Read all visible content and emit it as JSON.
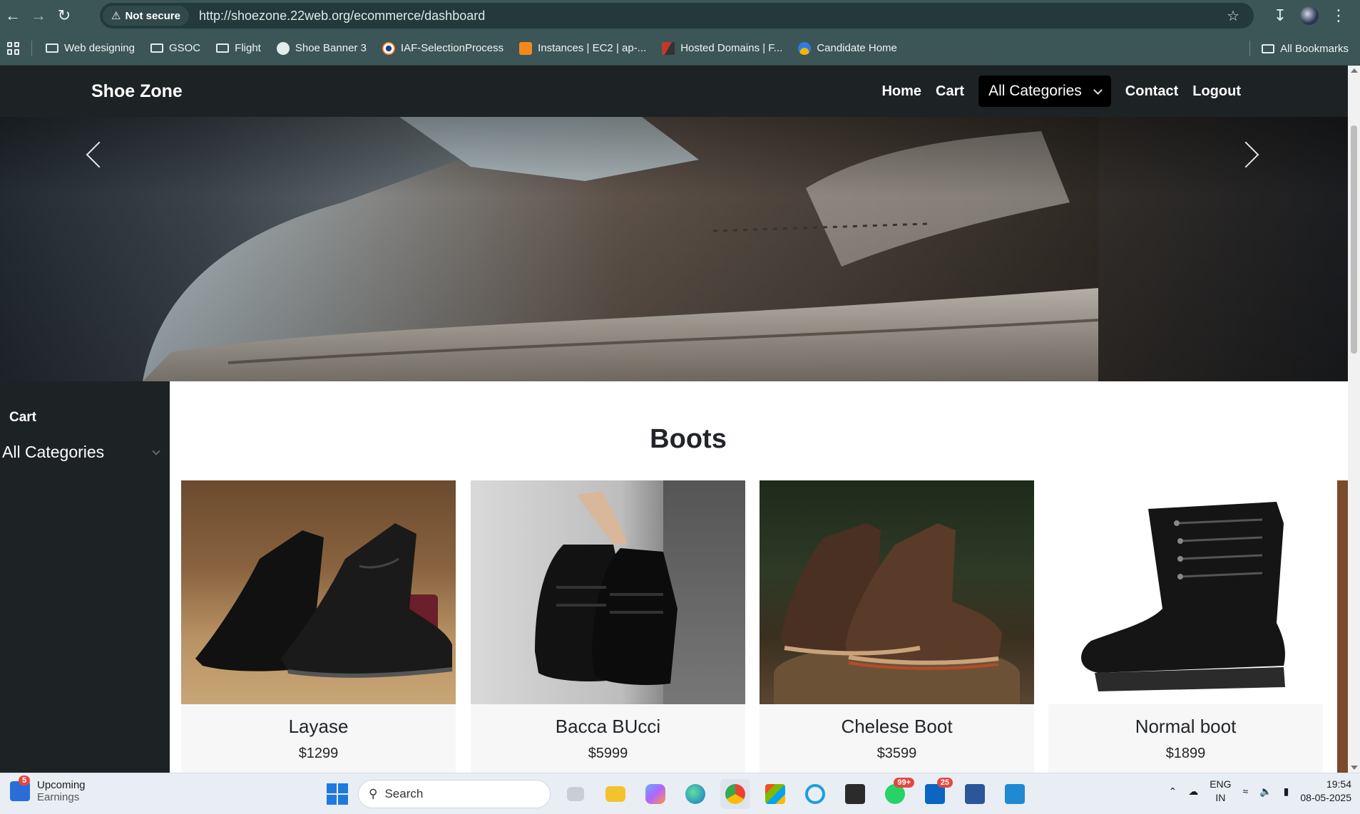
{
  "browser": {
    "security_label": "Not secure",
    "url": "http://shoezone.22web.org/ecommerce/dashboard",
    "bookmarks": [
      {
        "label": "Web designing",
        "icon": "folder-icon"
      },
      {
        "label": "GSOC",
        "icon": "folder-icon"
      },
      {
        "label": "Flight",
        "icon": "folder-icon"
      },
      {
        "label": "Shoe Banner 3",
        "icon": "globe-icon"
      },
      {
        "label": "IAF-SelectionProcess",
        "icon": "site-favicon"
      },
      {
        "label": "Instances | EC2 | ap-...",
        "icon": "aws-icon"
      },
      {
        "label": "Hosted Domains | F...",
        "icon": "site-favicon"
      },
      {
        "label": "Candidate Home",
        "icon": "site-favicon"
      }
    ],
    "all_bookmarks_label": "All Bookmarks"
  },
  "site": {
    "brand": "Shoe Zone",
    "nav": {
      "home": "Home",
      "cart": "Cart",
      "categories": "All Categories",
      "contact": "Contact",
      "logout": "Logout"
    },
    "sidebar": {
      "cart": "Cart",
      "categories": "All Categories"
    },
    "section_title": "Boots",
    "products": [
      {
        "name": "Layase",
        "price": "$1299"
      },
      {
        "name": "Bacca BUcci",
        "price": "$5999"
      },
      {
        "name": "Chelese Boot",
        "price": "$3599"
      },
      {
        "name": "Normal boot",
        "price": "$1899"
      }
    ]
  },
  "taskbar": {
    "weather_title": "Upcoming",
    "weather_sub": "Earnings",
    "weather_badge": "5",
    "search_placeholder": "Search",
    "whatsapp_badge": "99+",
    "linkedin_badge": "25",
    "lang_top": "ENG",
    "lang_bottom": "IN",
    "time": "19:54",
    "date": "08-05-2025"
  }
}
